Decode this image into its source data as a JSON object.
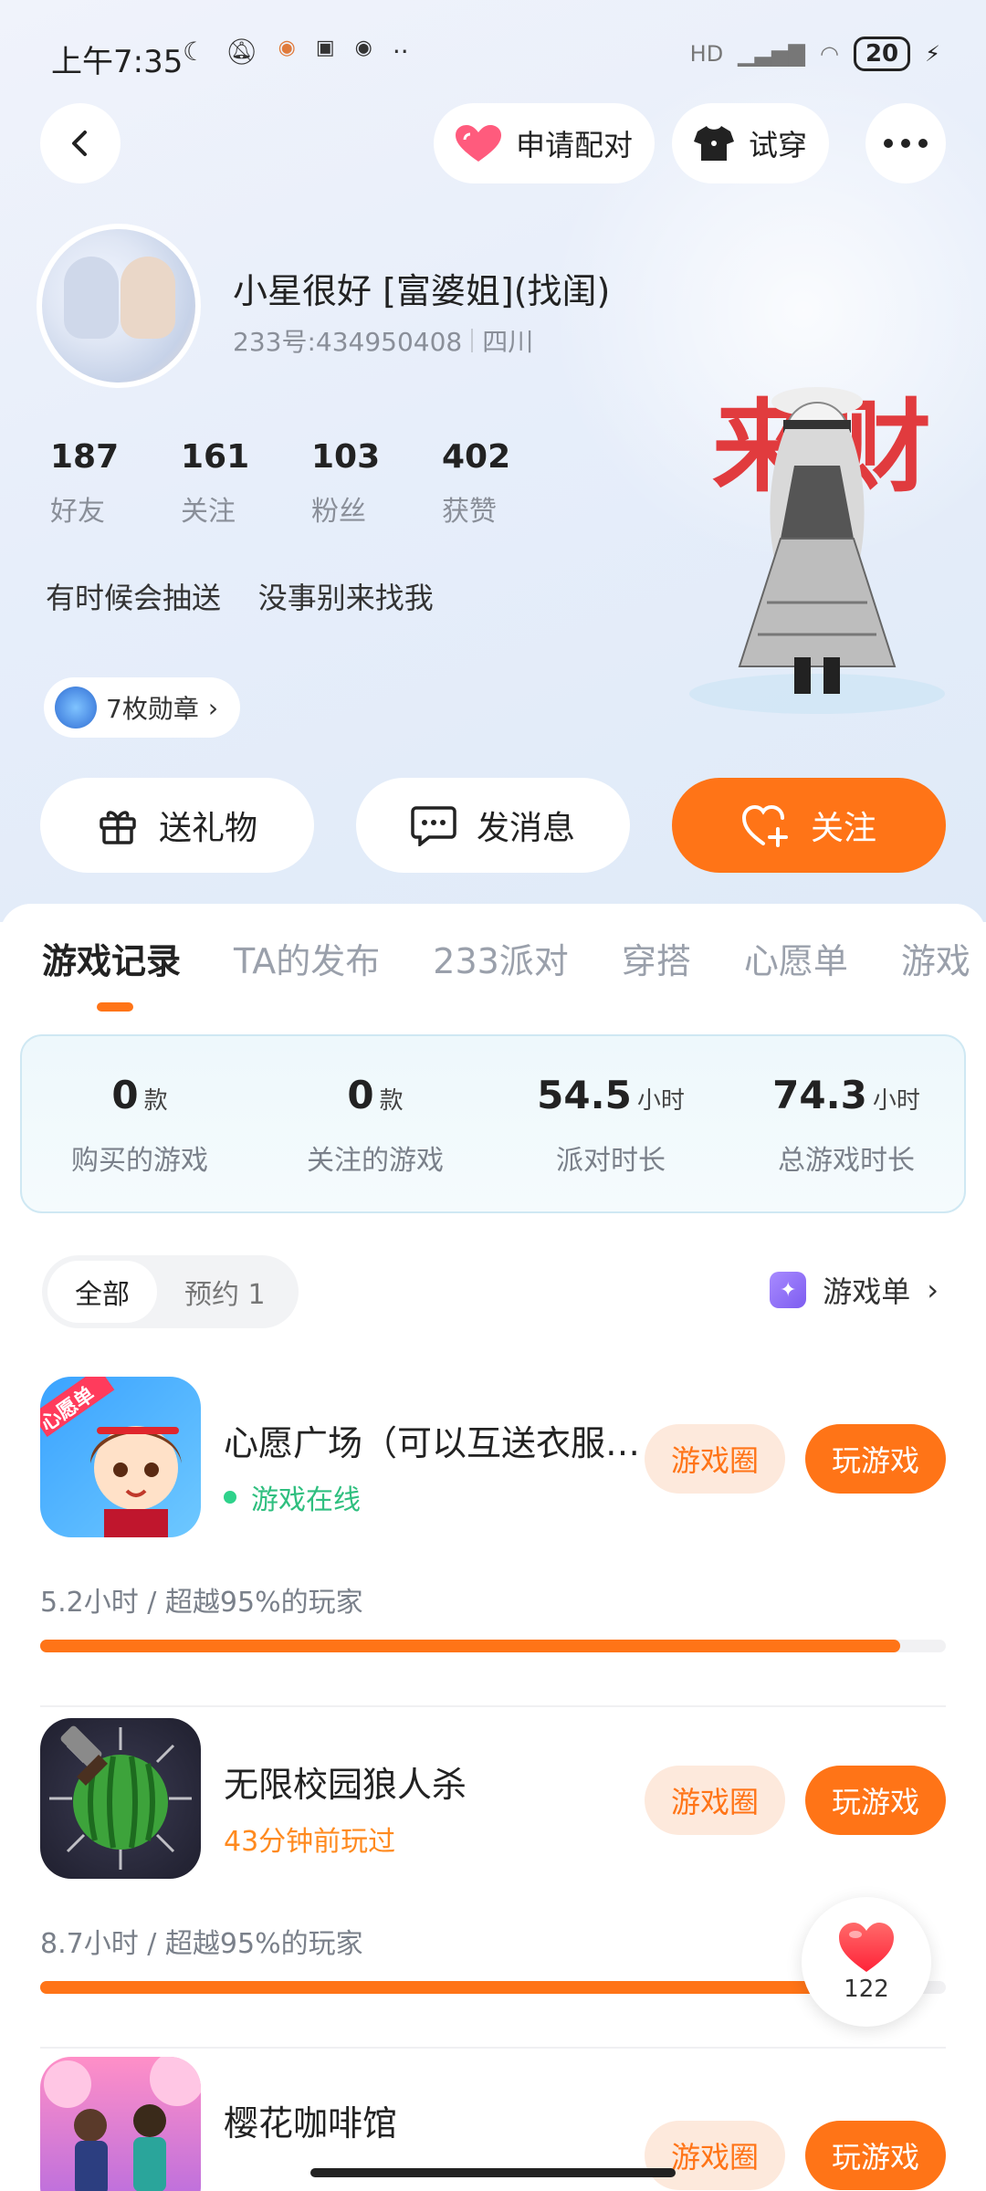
{
  "status_bar": {
    "time": "上午7:35",
    "left_icons": [
      "moon-icon",
      "mute-icon",
      "app-icon",
      "app-icon",
      "eye-icon",
      "more-dots-icon"
    ],
    "network": "HD",
    "battery": "20"
  },
  "header": {
    "match_label": "申请配对",
    "try_on_label": "试穿"
  },
  "profile": {
    "nickname": "小星很好 [富婆姐](找闺)",
    "user_id": "233号:434950408",
    "region": "四川",
    "stats": [
      {
        "num": "187",
        "label": "好友"
      },
      {
        "num": "161",
        "label": "关注"
      },
      {
        "num": "103",
        "label": "粉丝"
      },
      {
        "num": "402",
        "label": "获赞"
      }
    ],
    "bio": "有时候会抽送    没事别来找我",
    "badges_label": "7枚勋章",
    "figure_text": "来财"
  },
  "actions": {
    "gift": "送礼物",
    "message": "发消息",
    "follow": "关注"
  },
  "tabs": [
    "游戏记录",
    "TA的发布",
    "233派对",
    "穿搭",
    "心愿单",
    "游戏"
  ],
  "summary": [
    {
      "value": "0",
      "unit": "款",
      "label": "购买的游戏"
    },
    {
      "value": "0",
      "unit": "款",
      "label": "关注的游戏"
    },
    {
      "value": "54.5",
      "unit": "小时",
      "label": "派对时长"
    },
    {
      "value": "74.3",
      "unit": "小时",
      "label": "总游戏时长"
    }
  ],
  "filter": {
    "all": "全部",
    "reserve": "预约 1"
  },
  "game_list_link": "游戏单",
  "games": [
    {
      "name": "心愿广场（可以互送衣服…",
      "status": "游戏在线",
      "status_color": "#2fbf7f",
      "time": "5.2小时 / 超越95%的玩家",
      "progress": 0.95,
      "circle": "游戏圈",
      "play": "玩游戏",
      "icon_tag": "心愿单"
    },
    {
      "name": "无限校园狼人杀",
      "status": "43分钟前玩过",
      "status_color": "#ff8a1f",
      "time": "8.7小时 / 超越95%的玩家",
      "progress": 0.95,
      "circle": "游戏圈",
      "play": "玩游戏"
    },
    {
      "name": "樱花咖啡馆",
      "status": "",
      "status_color": "#ff8a1f",
      "time": "",
      "progress": 0,
      "circle": "游戏圈",
      "play": "玩游戏"
    }
  ],
  "like": {
    "count": "122"
  },
  "colors": {
    "accent": "#ff7417",
    "online": "#2fd28b"
  }
}
